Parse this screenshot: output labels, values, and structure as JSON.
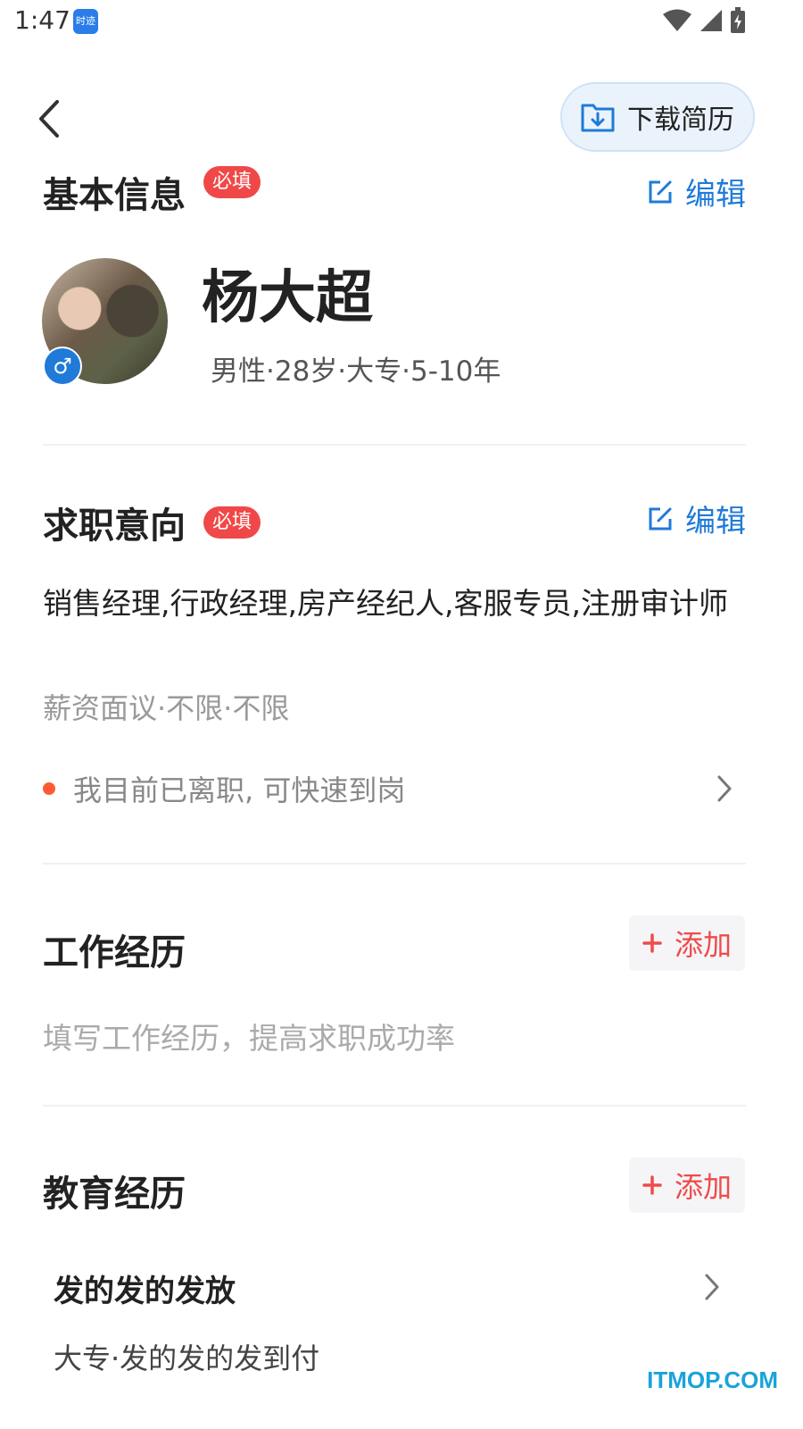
{
  "status_bar": {
    "time": "1:47",
    "app_badge": "时迹"
  },
  "header": {
    "download_label": "下载简历"
  },
  "basic_info": {
    "title": "基本信息",
    "required_badge": "必填",
    "edit_label": "编辑",
    "name": "杨大超",
    "meta": "男性·28岁·大专·5-10年",
    "gender_symbol": "♂"
  },
  "job_intent": {
    "title": "求职意向",
    "required_badge": "必填",
    "edit_label": "编辑",
    "positions": "销售经理,行政经理,房产经纪人,客服专员,注册审计师",
    "salary": "薪资面议·不限·不限",
    "status": "我目前已离职, 可快速到岗"
  },
  "work_experience": {
    "title": "工作经历",
    "add_label": "添加",
    "hint": "填写工作经历，提高求职成功率"
  },
  "education": {
    "title": "教育经历",
    "add_label": "添加",
    "items": [
      {
        "school": "发的发的发放",
        "detail": "大专·发的发的发到付"
      }
    ]
  },
  "watermark": "ITMOP.COM",
  "colors": {
    "accent_blue": "#1f7ad8",
    "required_red": "#f04848",
    "add_red": "#f04a4a",
    "status_dot": "#ff5a33"
  }
}
